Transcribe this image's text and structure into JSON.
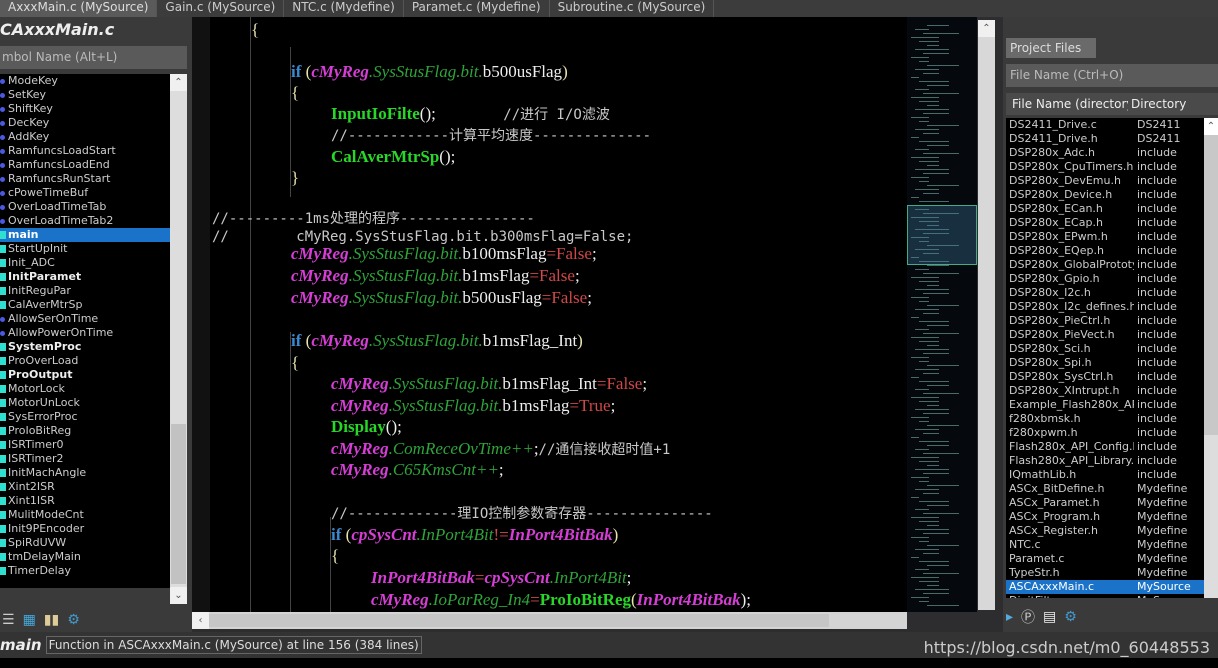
{
  "tabs": [
    {
      "label": "AxxxMain.c (MySource)",
      "active": true
    },
    {
      "label": "Gain.c (MySource)"
    },
    {
      "label": "NTC.c (Mydefine)"
    },
    {
      "label": "Paramet.c (Mydefine)"
    },
    {
      "label": "Subroutine.c (MySource)"
    }
  ],
  "symbols": {
    "file_title": "CAxxxMain.c",
    "search_placeholder": "mbol Name (Alt+L)",
    "items": [
      {
        "label": "ModeKey",
        "icon": "dot"
      },
      {
        "label": "SetKey",
        "icon": "dot"
      },
      {
        "label": "ShiftKey",
        "icon": "dot"
      },
      {
        "label": "DecKey",
        "icon": "dot"
      },
      {
        "label": "AddKey",
        "icon": "dot"
      },
      {
        "label": "RamfuncsLoadStart",
        "icon": "dot"
      },
      {
        "label": "RamfuncsLoadEnd",
        "icon": "dot"
      },
      {
        "label": "RamfuncsRunStart",
        "icon": "dot"
      },
      {
        "label": "cPoweTimeBuf",
        "icon": "dot"
      },
      {
        "label": "OverLoadTimeTab",
        "icon": "dot"
      },
      {
        "label": "OverLoadTimeTab2",
        "icon": "dot"
      },
      {
        "label": "main",
        "icon": "sq",
        "selected": true
      },
      {
        "label": "StartUpInit",
        "icon": "sq"
      },
      {
        "label": "Init_ADC",
        "icon": "sq"
      },
      {
        "label": "InitParamet",
        "icon": "sq",
        "bold": true
      },
      {
        "label": "InitReguPar",
        "icon": "sq"
      },
      {
        "label": "CalAverMtrSp",
        "icon": "sq"
      },
      {
        "label": "AllowSerOnTime",
        "icon": "dot"
      },
      {
        "label": "AllowPowerOnTime",
        "icon": "dot"
      },
      {
        "label": "SystemProc",
        "icon": "sq",
        "bold": true
      },
      {
        "label": "ProOverLoad",
        "icon": "sq"
      },
      {
        "label": "ProOutput",
        "icon": "sq",
        "bold": true
      },
      {
        "label": "MotorLock",
        "icon": "sq"
      },
      {
        "label": "MotorUnLock",
        "icon": "sq"
      },
      {
        "label": "SysErrorProc",
        "icon": "sq"
      },
      {
        "label": "ProIoBitReg",
        "icon": "sq"
      },
      {
        "label": "ISRTimer0",
        "icon": "sq"
      },
      {
        "label": "ISRTimer2",
        "icon": "sq"
      },
      {
        "label": "InitMachAngle",
        "icon": "sq"
      },
      {
        "label": "Xint2ISR",
        "icon": "sq"
      },
      {
        "label": "Xint1ISR",
        "icon": "sq"
      },
      {
        "label": "MulitModeCnt",
        "icon": "sq"
      },
      {
        "label": "Init9PEncoder",
        "icon": "sq"
      },
      {
        "label": "SpiRdUVW",
        "icon": "sq"
      },
      {
        "label": "tmDelayMain",
        "icon": "sq"
      },
      {
        "label": "TimerDelay",
        "icon": "sq"
      }
    ]
  },
  "code": [
    {
      "indent": 1,
      "tokens": [
        [
          "{",
          "par"
        ]
      ]
    },
    {
      "indent": 2,
      "tokens": [
        [
          "if",
          "kw"
        ],
        [
          " (",
          "par"
        ],
        [
          "cMyReg",
          "var"
        ],
        [
          ".SysStusFlag.bit.",
          "mem"
        ],
        [
          "b500usFlag",
          "pl"
        ],
        [
          ")",
          "par"
        ]
      ]
    },
    {
      "indent": 2,
      "tokens": [
        [
          "{",
          "par"
        ]
      ]
    },
    {
      "indent": 3,
      "tokens": [
        [
          "InputIoFilte",
          "fn"
        ],
        [
          "();",
          "pl"
        ],
        [
          "        //进行 I/O滤波",
          "com"
        ]
      ]
    },
    {
      "indent": 3,
      "tokens": [
        [
          "//------------计算平均速度--------------",
          "com"
        ]
      ]
    },
    {
      "indent": 3,
      "tokens": [
        [
          "CalAverMtrSp",
          "fn"
        ],
        [
          "();",
          "pl"
        ]
      ]
    },
    {
      "indent": 2,
      "tokens": [
        [
          "}",
          "par"
        ]
      ]
    },
    {
      "indent": 0,
      "tokens": [
        [
          "//---------1ms处理的程序----------------",
          "com"
        ]
      ]
    },
    {
      "indent": 0,
      "tokens": [
        [
          "//        cMyReg.SysStusFlag.bit.b300msFlag=False;",
          "com"
        ]
      ]
    },
    {
      "indent": 2,
      "tokens": [
        [
          "cMyReg",
          "var"
        ],
        [
          ".SysStusFlag.bit.",
          "mem"
        ],
        [
          "b100msFlag",
          "pl"
        ],
        [
          "=False",
          "red"
        ],
        [
          ";",
          "pl"
        ]
      ]
    },
    {
      "indent": 2,
      "tokens": [
        [
          "cMyReg",
          "var"
        ],
        [
          ".SysStusFlag.bit.",
          "mem"
        ],
        [
          "b1msFlag",
          "pl"
        ],
        [
          "=False",
          "red"
        ],
        [
          ";",
          "pl"
        ]
      ]
    },
    {
      "indent": 2,
      "tokens": [
        [
          "cMyReg",
          "var"
        ],
        [
          ".SysStusFlag.bit.",
          "mem"
        ],
        [
          "b500usFlag",
          "pl"
        ],
        [
          "=False",
          "red"
        ],
        [
          ";",
          "pl"
        ]
      ]
    },
    {
      "indent": 2,
      "tokens": [
        [
          "if",
          "kw"
        ],
        [
          " (",
          "par"
        ],
        [
          "cMyReg",
          "var"
        ],
        [
          ".SysStusFlag.bit.",
          "mem"
        ],
        [
          "b1msFlag_Int",
          "pl"
        ],
        [
          ")",
          "par"
        ]
      ]
    },
    {
      "indent": 2,
      "tokens": [
        [
          "{",
          "par"
        ]
      ]
    },
    {
      "indent": 3,
      "tokens": [
        [
          "cMyReg",
          "var"
        ],
        [
          ".SysStusFlag.bit.",
          "mem"
        ],
        [
          "b1msFlag_Int",
          "pl"
        ],
        [
          "=False",
          "red"
        ],
        [
          ";",
          "pl"
        ]
      ]
    },
    {
      "indent": 3,
      "tokens": [
        [
          "cMyReg",
          "var"
        ],
        [
          ".SysStusFlag.bit.",
          "mem"
        ],
        [
          "b1msFlag",
          "pl"
        ],
        [
          "=True",
          "red"
        ],
        [
          ";",
          "pl"
        ]
      ]
    },
    {
      "indent": 3,
      "tokens": [
        [
          "Display",
          "fn"
        ],
        [
          "();",
          "pl"
        ]
      ]
    },
    {
      "indent": 3,
      "tokens": [
        [
          "cMyReg",
          "var"
        ],
        [
          ".ComReceOvTime++",
          "mem"
        ],
        [
          ";",
          "pl"
        ],
        [
          "//通信接收超时值+1",
          "com"
        ]
      ]
    },
    {
      "indent": 3,
      "tokens": [
        [
          "cMyReg",
          "var"
        ],
        [
          ".C65KmsCnt++",
          "mem"
        ],
        [
          ";",
          "pl"
        ]
      ]
    },
    {
      "indent": 3,
      "tokens": [
        [
          "//-------------理IO控制参数寄存器---------------",
          "com"
        ]
      ]
    },
    {
      "indent": 3,
      "tokens": [
        [
          "if",
          "kw"
        ],
        [
          " (",
          "par"
        ],
        [
          "cpSysCnt",
          "var"
        ],
        [
          ".InPort4Bit",
          "mem"
        ],
        [
          "!=",
          "red"
        ],
        [
          "InPort4BitBak",
          "var"
        ],
        [
          ")",
          "par"
        ]
      ]
    },
    {
      "indent": 3,
      "tokens": [
        [
          "{",
          "par"
        ]
      ]
    },
    {
      "indent": 4,
      "tokens": [
        [
          "InPort4BitBak",
          "var"
        ],
        [
          "=",
          "red"
        ],
        [
          "cpSysCnt",
          "var"
        ],
        [
          ".InPort4Bit",
          "mem"
        ],
        [
          ";",
          "pl"
        ]
      ]
    },
    {
      "indent": 4,
      "tokens": [
        [
          "cMyReg",
          "var"
        ],
        [
          ".IoParReg_In4",
          "mem"
        ],
        [
          "=",
          "red"
        ],
        [
          "ProIoBitReg",
          "fn"
        ],
        [
          "(",
          "par"
        ],
        [
          "InPort4BitBak",
          "var"
        ],
        [
          ");",
          "pl"
        ]
      ]
    }
  ],
  "project_files": {
    "tab_label": "Project Files",
    "search_placeholder": "File Name (Ctrl+O)",
    "columns": [
      "File Name (directory",
      "Directory"
    ],
    "rows": [
      [
        "DS2411_Drive.c",
        "DS2411"
      ],
      [
        "DS2411_Drive.h",
        "DS2411"
      ],
      [
        "DSP280x_Adc.h",
        "include"
      ],
      [
        "DSP280x_CpuTimers.h",
        "include"
      ],
      [
        "DSP280x_DevEmu.h",
        "include"
      ],
      [
        "DSP280x_Device.h",
        "include"
      ],
      [
        "DSP280x_ECan.h",
        "include"
      ],
      [
        "DSP280x_ECap.h",
        "include"
      ],
      [
        "DSP280x_EPwm.h",
        "include"
      ],
      [
        "DSP280x_EQep.h",
        "include"
      ],
      [
        "DSP280x_GlobalPrototypes.h",
        "include"
      ],
      [
        "DSP280x_Gpio.h",
        "include"
      ],
      [
        "DSP280x_I2c.h",
        "include"
      ],
      [
        "DSP280x_I2c_defines.h",
        "include"
      ],
      [
        "DSP280x_PieCtrl.h",
        "include"
      ],
      [
        "DSP280x_PieVect.h",
        "include"
      ],
      [
        "DSP280x_Sci.h",
        "include"
      ],
      [
        "DSP280x_Spi.h",
        "include"
      ],
      [
        "DSP280x_SysCtrl.h",
        "include"
      ],
      [
        "DSP280x_XIntrupt.h",
        "include"
      ],
      [
        "Example_Flash280x_API.h",
        "include"
      ],
      [
        "f280xbmsk.h",
        "include"
      ],
      [
        "f280xpwm.h",
        "include"
      ],
      [
        "Flash280x_API_Config.h",
        "include"
      ],
      [
        "Flash280x_API_Library.h",
        "include"
      ],
      [
        "IQmathLib.h",
        "include"
      ],
      [
        "ASCx_BitDefine.h",
        "Mydefine"
      ],
      [
        "ASCx_Paramet.h",
        "Mydefine"
      ],
      [
        "ASCx_Program.h",
        "Mydefine"
      ],
      [
        "ASCx_Register.h",
        "Mydefine"
      ],
      [
        "NTC.c",
        "Mydefine"
      ],
      [
        "Paramet.c",
        "Mydefine"
      ],
      [
        "TypeStr.h",
        "Mydefine"
      ],
      [
        "ASCAxxxMain.c",
        "MySource"
      ],
      [
        "DigitFilter.c",
        "MySource"
      ]
    ],
    "selected_index": 33
  },
  "status": {
    "symbol": "main",
    "info": "Function in ASCAxxxMain.c (MySource) at line 156 (384 lines)"
  },
  "watermark": "https://blog.csdn.net/m0_60448553"
}
